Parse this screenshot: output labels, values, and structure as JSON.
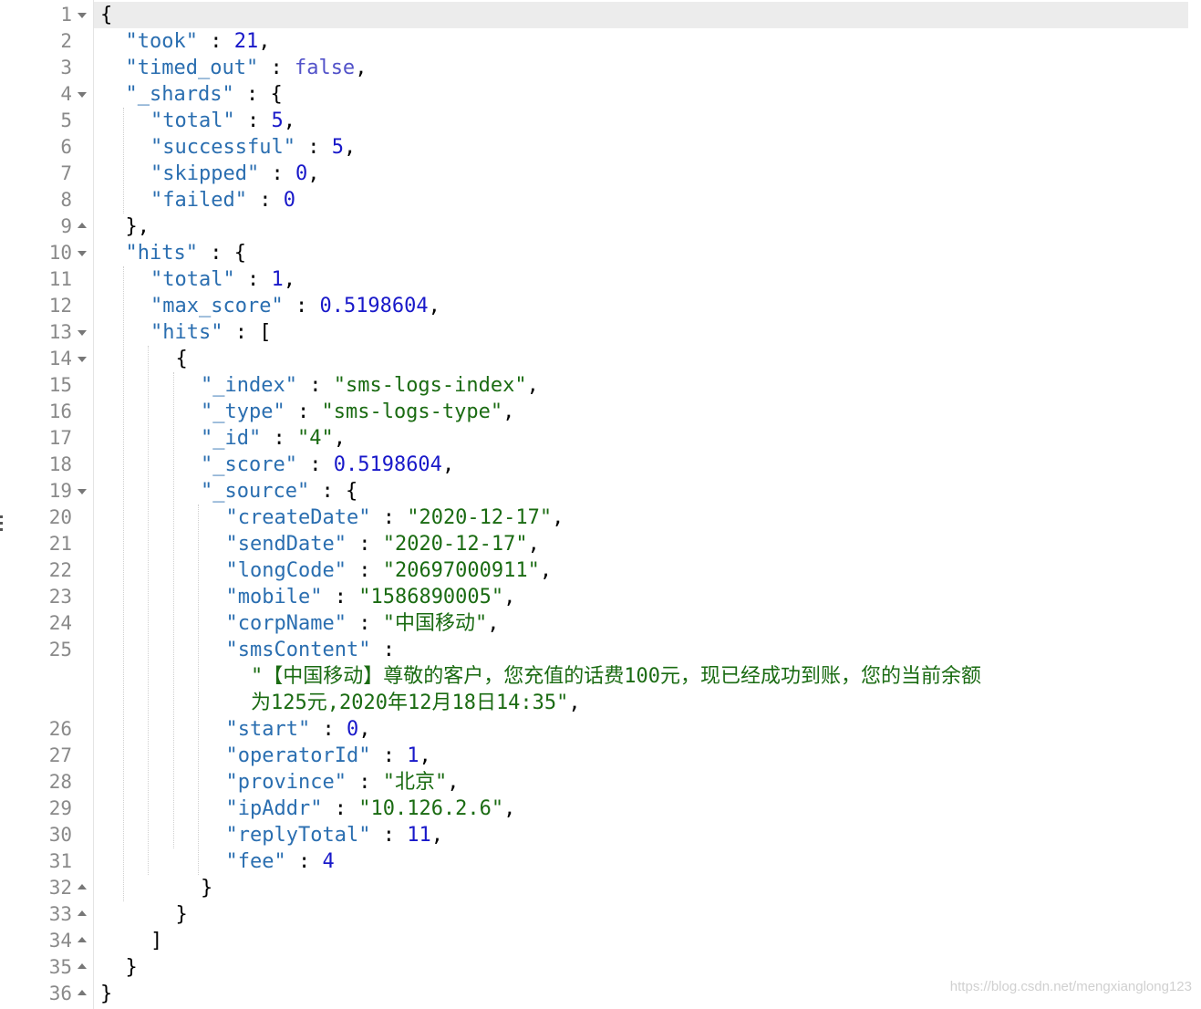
{
  "editor": {
    "lines": [
      {
        "n": "1",
        "fold": "down",
        "indent": 0,
        "tokens": [
          [
            "pun",
            "{"
          ]
        ]
      },
      {
        "n": "2",
        "indent": 1,
        "tokens": [
          [
            "key",
            "\"took\""
          ],
          [
            "pun",
            " : "
          ],
          [
            "num",
            "21"
          ],
          [
            "pun",
            ","
          ]
        ]
      },
      {
        "n": "3",
        "indent": 1,
        "tokens": [
          [
            "key",
            "\"timed_out\""
          ],
          [
            "pun",
            " : "
          ],
          [
            "bool",
            "false"
          ],
          [
            "pun",
            ","
          ]
        ]
      },
      {
        "n": "4",
        "fold": "down",
        "indent": 1,
        "tokens": [
          [
            "key",
            "\"_shards\""
          ],
          [
            "pun",
            " : {"
          ]
        ]
      },
      {
        "n": "5",
        "indent": 2,
        "tokens": [
          [
            "key",
            "\"total\""
          ],
          [
            "pun",
            " : "
          ],
          [
            "num",
            "5"
          ],
          [
            "pun",
            ","
          ]
        ]
      },
      {
        "n": "6",
        "indent": 2,
        "tokens": [
          [
            "key",
            "\"successful\""
          ],
          [
            "pun",
            " : "
          ],
          [
            "num",
            "5"
          ],
          [
            "pun",
            ","
          ]
        ]
      },
      {
        "n": "7",
        "indent": 2,
        "tokens": [
          [
            "key",
            "\"skipped\""
          ],
          [
            "pun",
            " : "
          ],
          [
            "num",
            "0"
          ],
          [
            "pun",
            ","
          ]
        ]
      },
      {
        "n": "8",
        "indent": 2,
        "tokens": [
          [
            "key",
            "\"failed\""
          ],
          [
            "pun",
            " : "
          ],
          [
            "num",
            "0"
          ]
        ]
      },
      {
        "n": "9",
        "fold": "up",
        "indent": 1,
        "tokens": [
          [
            "pun",
            "},"
          ]
        ]
      },
      {
        "n": "10",
        "fold": "down",
        "indent": 1,
        "tokens": [
          [
            "key",
            "\"hits\""
          ],
          [
            "pun",
            " : {"
          ]
        ]
      },
      {
        "n": "11",
        "indent": 2,
        "tokens": [
          [
            "key",
            "\"total\""
          ],
          [
            "pun",
            " : "
          ],
          [
            "num",
            "1"
          ],
          [
            "pun",
            ","
          ]
        ]
      },
      {
        "n": "12",
        "indent": 2,
        "tokens": [
          [
            "key",
            "\"max_score\""
          ],
          [
            "pun",
            " : "
          ],
          [
            "num",
            "0.5198604"
          ],
          [
            "pun",
            ","
          ]
        ]
      },
      {
        "n": "13",
        "fold": "down",
        "indent": 2,
        "tokens": [
          [
            "key",
            "\"hits\""
          ],
          [
            "pun",
            " : ["
          ]
        ]
      },
      {
        "n": "14",
        "fold": "down",
        "indent": 3,
        "tokens": [
          [
            "pun",
            "{"
          ]
        ]
      },
      {
        "n": "15",
        "indent": 4,
        "tokens": [
          [
            "key",
            "\"_index\""
          ],
          [
            "pun",
            " : "
          ],
          [
            "str",
            "\"sms-logs-index\""
          ],
          [
            "pun",
            ","
          ]
        ]
      },
      {
        "n": "16",
        "indent": 4,
        "tokens": [
          [
            "key",
            "\"_type\""
          ],
          [
            "pun",
            " : "
          ],
          [
            "str",
            "\"sms-logs-type\""
          ],
          [
            "pun",
            ","
          ]
        ]
      },
      {
        "n": "17",
        "indent": 4,
        "tokens": [
          [
            "key",
            "\"_id\""
          ],
          [
            "pun",
            " : "
          ],
          [
            "str",
            "\"4\""
          ],
          [
            "pun",
            ","
          ]
        ]
      },
      {
        "n": "18",
        "indent": 4,
        "tokens": [
          [
            "key",
            "\"_score\""
          ],
          [
            "pun",
            " : "
          ],
          [
            "num",
            "0.5198604"
          ],
          [
            "pun",
            ","
          ]
        ]
      },
      {
        "n": "19",
        "fold": "down",
        "indent": 4,
        "tokens": [
          [
            "key",
            "\"_source\""
          ],
          [
            "pun",
            " : {"
          ]
        ]
      },
      {
        "n": "20",
        "indent": 5,
        "tokens": [
          [
            "key",
            "\"createDate\""
          ],
          [
            "pun",
            " : "
          ],
          [
            "str",
            "\"2020-12-17\""
          ],
          [
            "pun",
            ","
          ]
        ]
      },
      {
        "n": "21",
        "indent": 5,
        "tokens": [
          [
            "key",
            "\"sendDate\""
          ],
          [
            "pun",
            " : "
          ],
          [
            "str",
            "\"2020-12-17\""
          ],
          [
            "pun",
            ","
          ]
        ]
      },
      {
        "n": "22",
        "indent": 5,
        "tokens": [
          [
            "key",
            "\"longCode\""
          ],
          [
            "pun",
            " : "
          ],
          [
            "str",
            "\"20697000911\""
          ],
          [
            "pun",
            ","
          ]
        ]
      },
      {
        "n": "23",
        "indent": 5,
        "tokens": [
          [
            "key",
            "\"mobile\""
          ],
          [
            "pun",
            " : "
          ],
          [
            "str",
            "\"1586890005\""
          ],
          [
            "pun",
            ","
          ]
        ]
      },
      {
        "n": "24",
        "indent": 5,
        "tokens": [
          [
            "key",
            "\"corpName\""
          ],
          [
            "pun",
            " : "
          ],
          [
            "str",
            "\"中国移动\""
          ],
          [
            "pun",
            ","
          ]
        ]
      },
      {
        "n": "25",
        "indent": 5,
        "tokens": [
          [
            "key",
            "\"smsContent\""
          ],
          [
            "pun",
            " :"
          ]
        ]
      },
      {
        "n": "",
        "indent": 6,
        "tokens": [
          [
            "str",
            "\"【中国移动】尊敬的客户，您充值的话费100元，现已经成功到账，您的当前余额"
          ]
        ]
      },
      {
        "n": "",
        "indent": 6,
        "tokens": [
          [
            "str",
            "为125元,2020年12月18日14:35\""
          ],
          [
            "pun",
            ","
          ]
        ]
      },
      {
        "n": "26",
        "indent": 5,
        "tokens": [
          [
            "key",
            "\"start\""
          ],
          [
            "pun",
            " : "
          ],
          [
            "num",
            "0"
          ],
          [
            "pun",
            ","
          ]
        ]
      },
      {
        "n": "27",
        "indent": 5,
        "tokens": [
          [
            "key",
            "\"operatorId\""
          ],
          [
            "pun",
            " : "
          ],
          [
            "num",
            "1"
          ],
          [
            "pun",
            ","
          ]
        ]
      },
      {
        "n": "28",
        "indent": 5,
        "tokens": [
          [
            "key",
            "\"province\""
          ],
          [
            "pun",
            " : "
          ],
          [
            "str",
            "\"北京\""
          ],
          [
            "pun",
            ","
          ]
        ]
      },
      {
        "n": "29",
        "indent": 5,
        "tokens": [
          [
            "key",
            "\"ipAddr\""
          ],
          [
            "pun",
            " : "
          ],
          [
            "str",
            "\"10.126.2.6\""
          ],
          [
            "pun",
            ","
          ]
        ]
      },
      {
        "n": "30",
        "indent": 5,
        "tokens": [
          [
            "key",
            "\"replyTotal\""
          ],
          [
            "pun",
            " : "
          ],
          [
            "num",
            "11"
          ],
          [
            "pun",
            ","
          ]
        ]
      },
      {
        "n": "31",
        "indent": 5,
        "tokens": [
          [
            "key",
            "\"fee\""
          ],
          [
            "pun",
            " : "
          ],
          [
            "num",
            "4"
          ]
        ]
      },
      {
        "n": "32",
        "fold": "up",
        "indent": 4,
        "tokens": [
          [
            "pun",
            "}"
          ]
        ]
      },
      {
        "n": "33",
        "fold": "up",
        "indent": 3,
        "tokens": [
          [
            "pun",
            "}"
          ]
        ]
      },
      {
        "n": "34",
        "fold": "up",
        "indent": 2,
        "tokens": [
          [
            "pun",
            "]"
          ]
        ]
      },
      {
        "n": "35",
        "fold": "up",
        "indent": 1,
        "tokens": [
          [
            "pun",
            "}"
          ]
        ]
      },
      {
        "n": "36",
        "fold": "up",
        "indent": 0,
        "tokens": [
          [
            "pun",
            "}"
          ]
        ]
      }
    ],
    "guides": [
      {
        "level": 1,
        "from": 4,
        "to": 7
      },
      {
        "level": 1,
        "from": 10,
        "to": 33
      },
      {
        "level": 2,
        "from": 13,
        "to": 32
      },
      {
        "level": 3,
        "from": 14,
        "to": 31
      },
      {
        "level": 4,
        "from": 19,
        "to": 32
      }
    ]
  },
  "watermark": "https://blog.csdn.net/mengxianglong123"
}
